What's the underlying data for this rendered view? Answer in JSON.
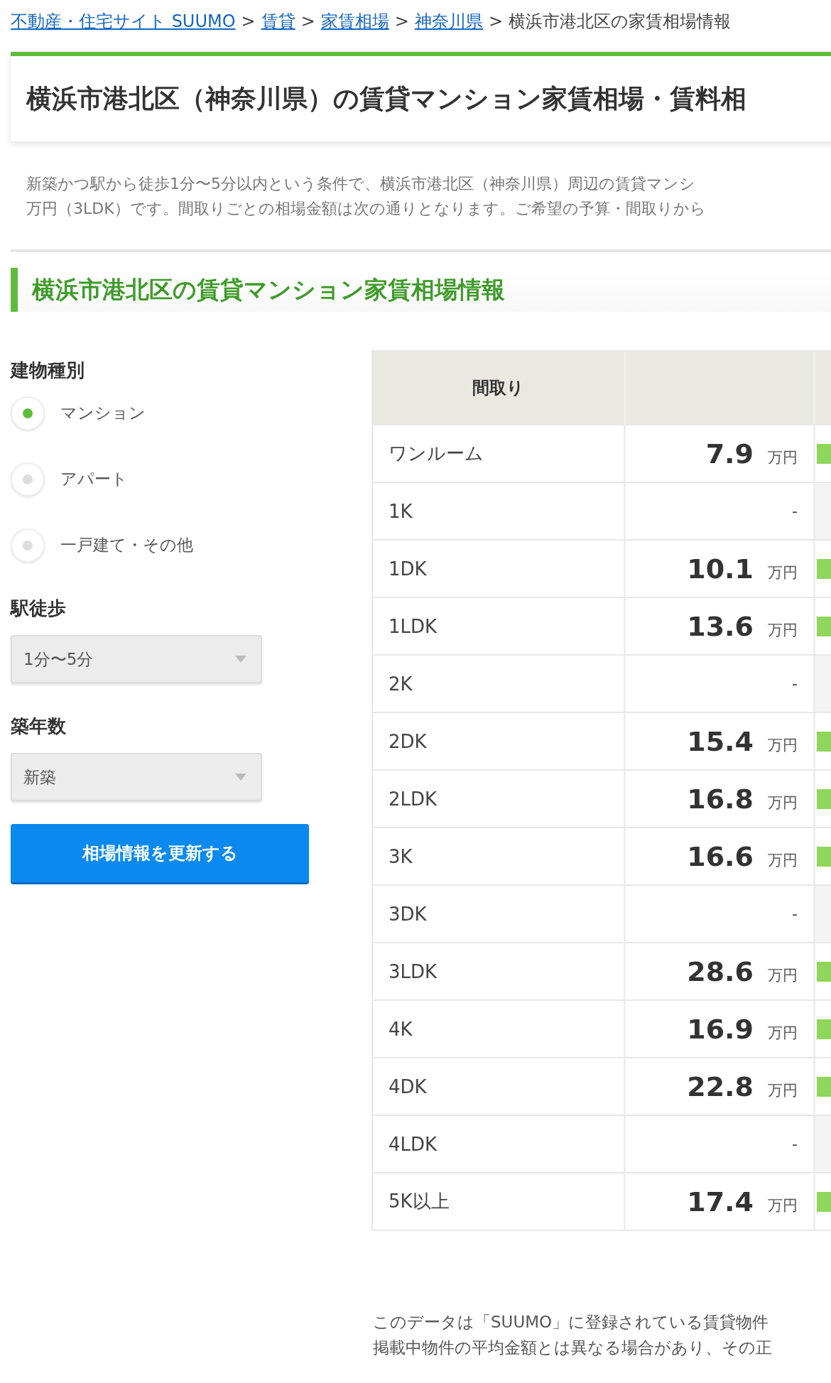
{
  "breadcrumb": [
    {
      "label": "不動産・住宅サイト SUUMO",
      "link": true
    },
    {
      "label": "賃貸",
      "link": true
    },
    {
      "label": "家賃相場",
      "link": true
    },
    {
      "label": "神奈川県",
      "link": true
    },
    {
      "label": "横浜市港北区の家賃相場情報",
      "link": false
    }
  ],
  "breadcrumb_separator": ">",
  "page_title": "横浜市港北区（神奈川県）の賃貸マンション家賃相場・賃料相",
  "intro_lines": [
    "新築かつ駅から徒歩1分〜5分以内という条件で、横浜市港北区（神奈川県）周辺の賃貸マンシ",
    "万円（3LDK）です。間取りごとの相場金額は次の通りとなります。ご希望の予算・間取りから"
  ],
  "section_title": "横浜市港北区の賃貸マンション家賃相場情報",
  "filters": {
    "building_type": {
      "label": "建物種別",
      "options": [
        {
          "label": "マンション",
          "selected": true
        },
        {
          "label": "アパート",
          "selected": false
        },
        {
          "label": "一戸建て・その他",
          "selected": false
        }
      ]
    },
    "walk": {
      "label": "駅徒歩",
      "value": "1分〜5分"
    },
    "age": {
      "label": "築年数",
      "value": "新築"
    },
    "submit": "相場情報を更新する"
  },
  "table": {
    "columns": [
      "間取り"
    ],
    "rows": [
      {
        "layout": "ワンルーム",
        "kind": "price",
        "price": "7.9",
        "unit": "万円"
      },
      {
        "layout": "1K",
        "kind": "none",
        "price": "-"
      },
      {
        "layout": "1DK",
        "kind": "price",
        "price": "10.1",
        "unit": "万円"
      },
      {
        "layout": "1LDK",
        "kind": "price",
        "price": "13.6",
        "unit": "万円"
      },
      {
        "layout": "2K",
        "kind": "none",
        "price": "-"
      },
      {
        "layout": "2DK",
        "kind": "price",
        "price": "15.4",
        "unit": "万円"
      },
      {
        "layout": "2LDK",
        "kind": "price",
        "price": "16.8",
        "unit": "万円"
      },
      {
        "layout": "3K",
        "kind": "price",
        "price": "16.6",
        "unit": "万円"
      },
      {
        "layout": "3DK",
        "kind": "none",
        "price": "-"
      },
      {
        "layout": "3LDK",
        "kind": "price",
        "price": "28.6",
        "unit": "万円"
      },
      {
        "layout": "4K",
        "kind": "price",
        "price": "16.9",
        "unit": "万円"
      },
      {
        "layout": "4DK",
        "kind": "price",
        "price": "22.8",
        "unit": "万円"
      },
      {
        "layout": "4LDK",
        "kind": "none",
        "price": "-"
      },
      {
        "layout": "5K以上",
        "kind": "price",
        "price": "17.4",
        "unit": "万円"
      }
    ]
  },
  "note_lines": [
    "このデータは「SUUMO」に登録されている賃貸物件",
    "掲載中物件の平均金額とは異なる場合があり、その正"
  ]
}
